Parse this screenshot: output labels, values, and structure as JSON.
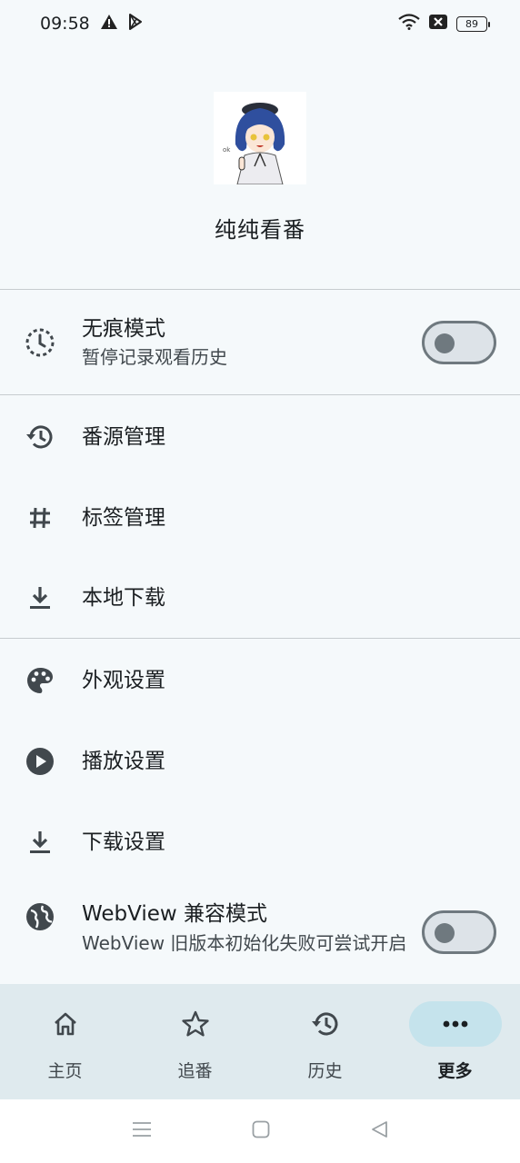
{
  "status_bar": {
    "time": "09:58",
    "icons": [
      "warning-icon",
      "play-store-icon",
      "wifi-icon",
      "sim-off-icon"
    ],
    "battery": "89"
  },
  "header": {
    "app_name": "纯纯看番"
  },
  "incognito": {
    "title": "无痕模式",
    "subtitle": "暂停记录观看历史",
    "enabled": false
  },
  "menu_group_1": [
    {
      "label": "番源管理",
      "icon": "history-icon"
    },
    {
      "label": "标签管理",
      "icon": "tag-hash-icon"
    },
    {
      "label": "本地下载",
      "icon": "download-icon"
    }
  ],
  "menu_group_2": [
    {
      "label": "外观设置",
      "icon": "palette-icon"
    },
    {
      "label": "播放设置",
      "icon": "play-circle-icon"
    },
    {
      "label": "下载设置",
      "icon": "download-icon"
    }
  ],
  "webview": {
    "title": "WebView 兼容模式",
    "subtitle": "WebView 旧版本初始化失败可尝试开启",
    "enabled": false,
    "icon": "globe-icon"
  },
  "bottom_nav": [
    {
      "label": "主页",
      "icon": "home-icon",
      "active": false
    },
    {
      "label": "追番",
      "icon": "star-icon",
      "active": false
    },
    {
      "label": "历史",
      "icon": "history-icon",
      "active": false
    },
    {
      "label": "更多",
      "icon": "more-icon",
      "active": true
    }
  ],
  "colors": {
    "background": "#f5f9fb",
    "nav_background": "#dfeaee",
    "active_pill": "#c5e3ec",
    "switch_outline": "#6f797f"
  }
}
